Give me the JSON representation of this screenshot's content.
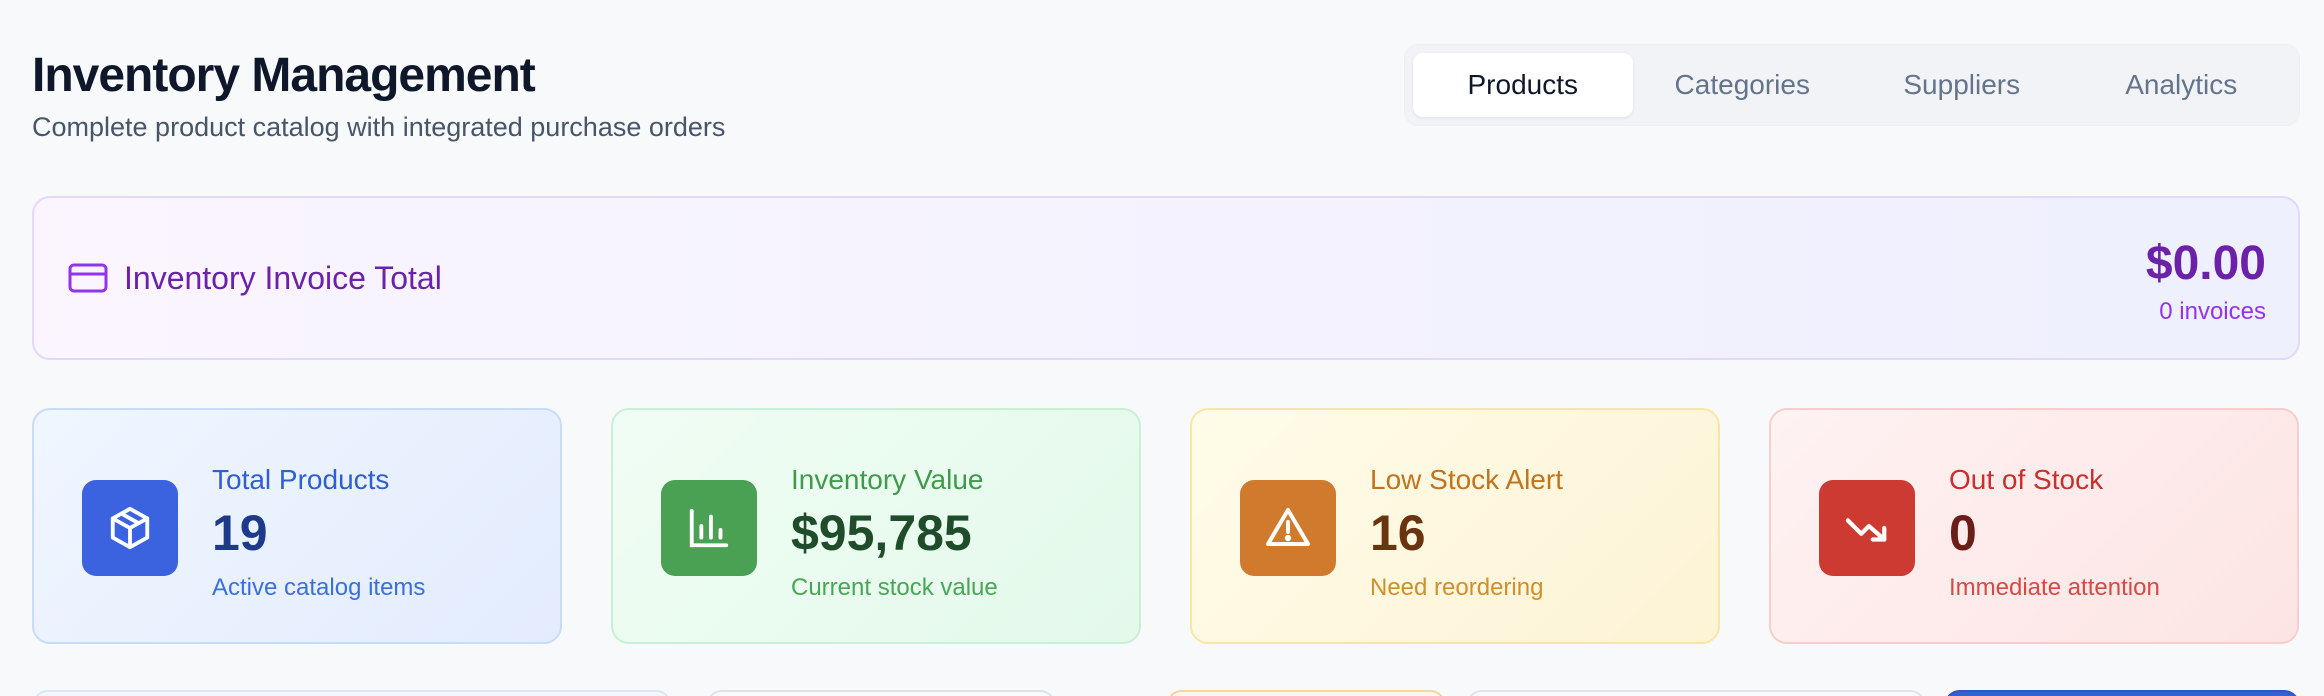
{
  "header": {
    "title": "Inventory Management",
    "subtitle": "Complete product catalog with integrated purchase orders"
  },
  "tabs": [
    {
      "label": "Products",
      "active": true
    },
    {
      "label": "Categories",
      "active": false
    },
    {
      "label": "Suppliers",
      "active": false
    },
    {
      "label": "Analytics",
      "active": false
    }
  ],
  "invoice": {
    "icon": "credit-card-icon",
    "label": "Inventory Invoice Total",
    "total": "$0.00",
    "count": "0 invoices"
  },
  "stats": [
    {
      "icon": "package-icon",
      "label": "Total Products",
      "value": "19",
      "description": "Active catalog items",
      "color": "#3b63e0"
    },
    {
      "icon": "bar-chart-icon",
      "label": "Inventory Value",
      "value": "$95,785",
      "description": "Current stock value",
      "color": "#4aa154"
    },
    {
      "icon": "alert-triangle-icon",
      "label": "Low Stock Alert",
      "value": "16",
      "description": "Need reordering",
      "color": "#cf7a2c"
    },
    {
      "icon": "trending-down-icon",
      "label": "Out of Stock",
      "value": "0",
      "description": "Immediate attention",
      "color": "#cc3a32"
    }
  ],
  "colors": {
    "accent_purple": "#6b21a8",
    "active_tab_bg": "#ffffff",
    "page_bg": "#f8f9fb"
  }
}
